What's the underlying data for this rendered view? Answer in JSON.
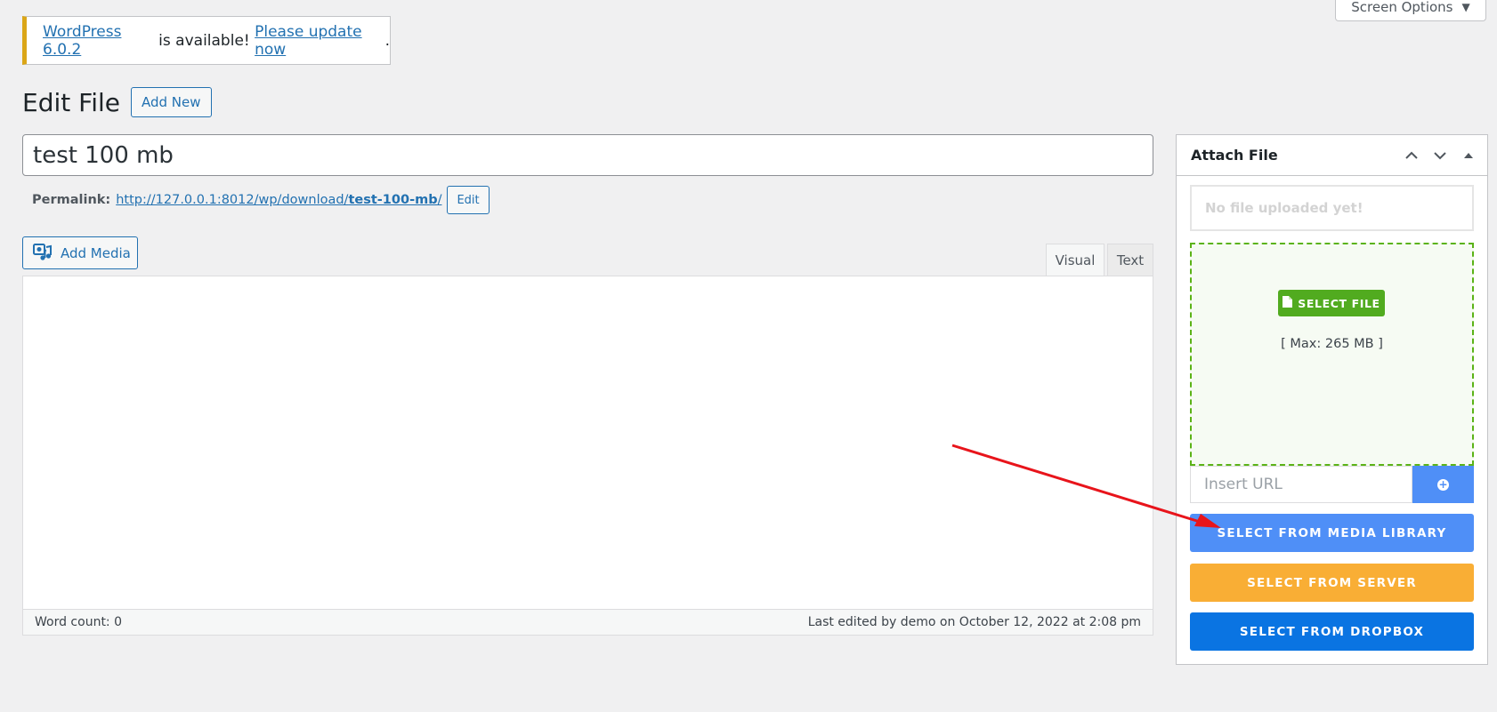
{
  "screen_options": {
    "label": "Screen Options",
    "caret": "▼"
  },
  "notice": {
    "version_link": "WordPress 6.0.2",
    "middle_text": " is available! ",
    "update_link": "Please update now",
    "end_text": "."
  },
  "heading": {
    "title": "Edit File",
    "add_new": "Add New"
  },
  "title_field": {
    "value": "test 100 mb"
  },
  "permalink": {
    "label": "Permalink:",
    "url_base": "http://127.0.0.1:8012/wp/download/",
    "slug": "test-100-mb",
    "url_end": "/",
    "edit_label": "Edit"
  },
  "editor": {
    "add_media": "Add Media",
    "tab_visual": "Visual",
    "tab_text": "Text",
    "word_count": "Word count: 0",
    "last_edited": "Last edited by demo on October 12, 2022 at 2:08 pm"
  },
  "attach_panel": {
    "title": "Attach File",
    "no_file": "No file uploaded yet!",
    "select_file": "SELECT FILE",
    "max_size": "[ Max: 265 MB ]",
    "url_placeholder": "Insert URL",
    "btn_media_library": "SELECT FROM MEDIA LIBRARY",
    "btn_server": "SELECT FROM SERVER",
    "btn_dropbox": "SELECT FROM DROPBOX"
  },
  "colors": {
    "wp_blue": "#2271b1",
    "notice_warning": "#dba617",
    "select_file_green": "#51ab1f",
    "media_library_blue": "#4f8ff7",
    "server_orange": "#f9ae35",
    "dropbox_blue": "#0a74e2",
    "annotation_arrow": "#e8141b"
  }
}
